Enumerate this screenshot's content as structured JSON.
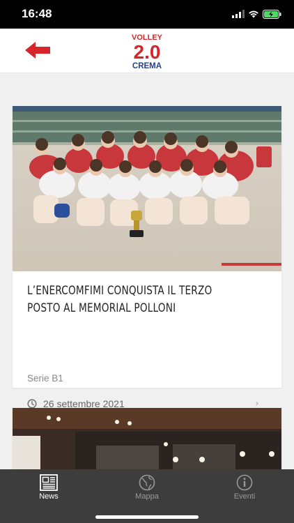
{
  "status_bar": {
    "time": "16:48"
  },
  "header": {
    "back_icon": "arrow-left-icon",
    "logo": {
      "line1": "VOLLEY",
      "line2": "2.0",
      "line3": "CREMA"
    }
  },
  "feed": {
    "articles": [
      {
        "title": "L’ENERCOMFIMI CONQUISTA IL TERZO POSTO AL MEMORIAL POLLONI",
        "category": "Serie B1",
        "date": "26 settembre 2021"
      }
    ]
  },
  "tabs": [
    {
      "label": "News",
      "icon": "newspaper-icon",
      "active": true
    },
    {
      "label": "Mappa",
      "icon": "globe-map-icon",
      "active": false
    },
    {
      "label": "Eventi",
      "icon": "info-icon",
      "active": false
    }
  ],
  "colors": {
    "accent": "#d6262b",
    "brand_blue": "#27408b",
    "tab_bar": "#3d3d3d"
  }
}
